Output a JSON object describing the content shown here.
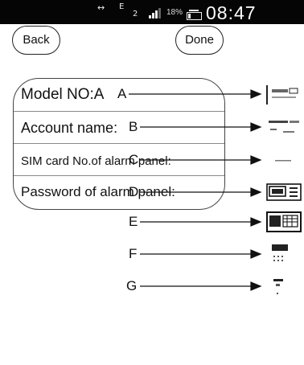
{
  "status_bar": {
    "battery_percent": "18%",
    "signal_label": "2",
    "data_label": "E",
    "time": "08:47"
  },
  "header": {
    "back_label": "Back",
    "done_label": "Done"
  },
  "form": {
    "rows": [
      {
        "label": "Model NO:A"
      },
      {
        "label": "Account name:"
      },
      {
        "label": "SIM card No.of alarm panel:"
      },
      {
        "label": "Password of alarm panel:"
      }
    ]
  },
  "callouts": [
    "A",
    "B",
    "C",
    "D",
    "E",
    "F",
    "G"
  ]
}
